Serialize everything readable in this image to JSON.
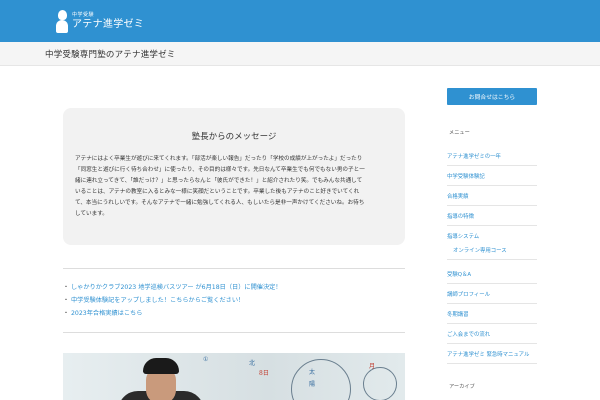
{
  "header": {
    "logo_small": "中学受験",
    "logo_main": "アテナ進学ゼミ"
  },
  "page": {
    "title": "中学受験専門塾のアテナ進学ゼミ"
  },
  "message": {
    "title": "塾長からのメッセージ",
    "lines": [
      "アテナにはよく卒業生が遊びに来てくれます。「部活が楽しい報告」だったり「学校の成績が上がったよ」だったり",
      "「同窓生と遊びに行く待ち合わせ」に使ったり、その目的は様々です。先日なんて卒業生でも何でもない男の子と一",
      "緒に連れ立ってきて、「誰だっけ？」と思ったらなんと「彼氏ができた！」と紹介されたり笑。でもみんな共通して",
      "いることは、アテナの教室に入るとみな一様に笑顔だということです。卒業した後もアテナのこと好きでいてくれ",
      "て、本当にうれしいです。そんなアテナで一緒に勉強してくれる人、もしいたら是非一声かけてくださいね。お待ち",
      "しています。"
    ]
  },
  "news": [
    "しゃかりかクラブ2023 地学巡検バスツアー が6月18日（日）に開催決定！",
    "中学受験体験記をアップしました！こちらからご覧ください！",
    "2023年合格実績はこちら"
  ],
  "photo": {
    "chalk_marks": [
      "①",
      "北",
      "8日",
      "太",
      "陽",
      "月"
    ]
  },
  "sidebar": {
    "contact_label": "お問合せはこちら",
    "menu_heading": "メニュー",
    "menu_items": [
      "アテナ進学ゼミの一年",
      "中学受験体験記",
      "合格実績",
      "指導の特徴",
      "指導システム",
      "オンライン専用コース",
      "受験Q＆A",
      "講師プロフィール",
      "冬期講習",
      "ご入会までの流れ",
      "アテナ進学ゼミ 緊急時マニュアル"
    ],
    "archive_heading": "アーカイブ"
  }
}
